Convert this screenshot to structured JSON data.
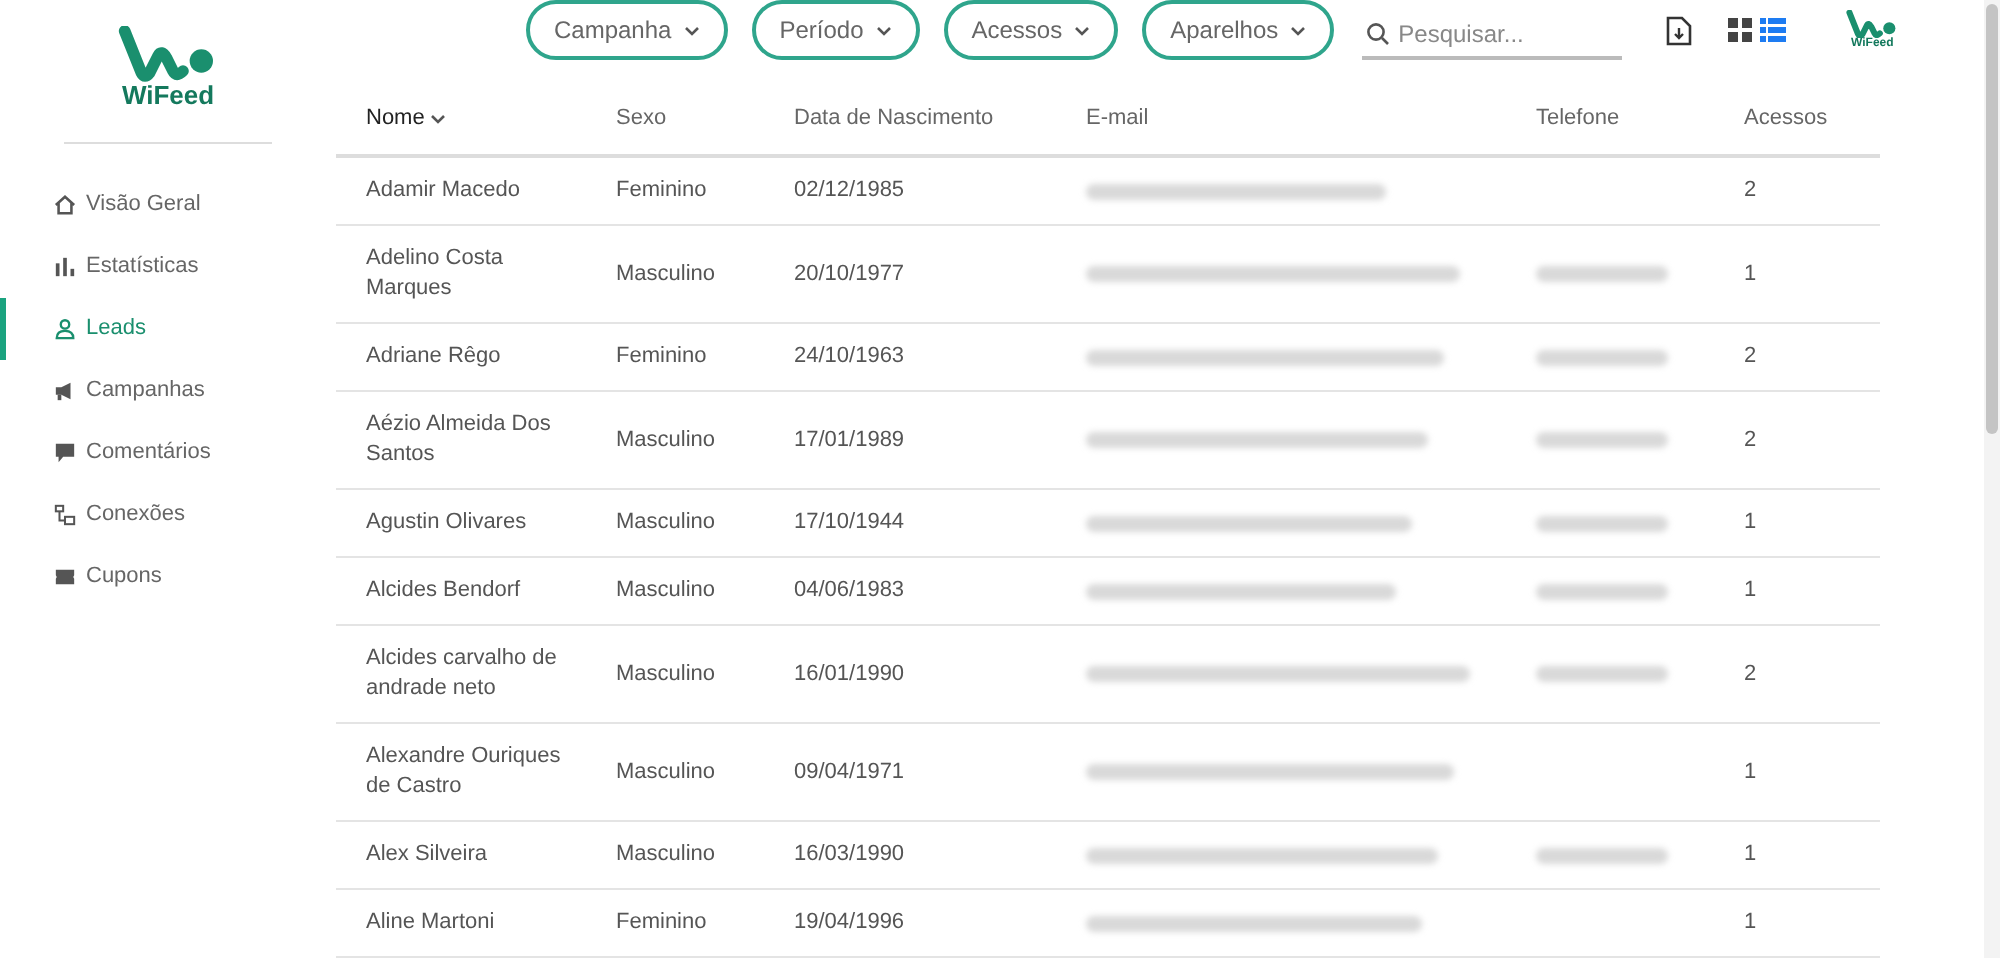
{
  "logo": {
    "text": "WiFeed"
  },
  "filters": [
    {
      "label": "Campanha"
    },
    {
      "label": "Período"
    },
    {
      "label": "Acessos"
    },
    {
      "label": "Aparelhos"
    }
  ],
  "search": {
    "placeholder": "Pesquisar..."
  },
  "view_toggle": [
    {
      "kind": "grid",
      "selected": false
    },
    {
      "kind": "list",
      "selected": true
    }
  ],
  "small_logo": {
    "text": "WiFeed"
  },
  "sidebar": {
    "items": [
      {
        "label": "Visão Geral",
        "selected": false
      },
      {
        "label": "Estatísticas",
        "selected": false
      },
      {
        "label": "Leads",
        "selected": true
      },
      {
        "label": "Campanhas",
        "selected": false
      },
      {
        "label": "Comentários",
        "selected": false
      },
      {
        "label": "Conexões",
        "selected": false
      },
      {
        "label": "Cupons",
        "selected": false
      }
    ]
  },
  "table": {
    "columns": [
      {
        "label": "Nome",
        "sorted": true
      },
      {
        "label": "Sexo",
        "sorted": false
      },
      {
        "label": "Data de Nascimento",
        "sorted": false
      },
      {
        "label": "E-mail",
        "sorted": false
      },
      {
        "label": "Telefone",
        "sorted": false
      },
      {
        "label": "Acessos",
        "sorted": false
      }
    ],
    "rows": [
      {
        "name": "Adamir Macedo",
        "sex": "Feminino",
        "birth": "02/12/1985",
        "email_redacted": true,
        "phone_redacted": false,
        "accesses": "2"
      },
      {
        "name": "Adelino Costa Marques",
        "sex": "Masculino",
        "birth": "20/10/1977",
        "email_redacted": true,
        "phone_redacted": true,
        "accesses": "1"
      },
      {
        "name": "Adriane Rêgo",
        "sex": "Feminino",
        "birth": "24/10/1963",
        "email_redacted": true,
        "phone_redacted": true,
        "accesses": "2"
      },
      {
        "name": "Aézio Almeida Dos Santos",
        "sex": "Masculino",
        "birth": "17/01/1989",
        "email_redacted": true,
        "phone_redacted": true,
        "accesses": "2"
      },
      {
        "name": "Agustin Olivares",
        "sex": "Masculino",
        "birth": "17/10/1944",
        "email_redacted": true,
        "phone_redacted": true,
        "accesses": "1"
      },
      {
        "name": "Alcides Bendorf",
        "sex": "Masculino",
        "birth": "04/06/1983",
        "email_redacted": true,
        "phone_redacted": true,
        "accesses": "1"
      },
      {
        "name": "Alcides carvalho de andrade neto",
        "sex": "Masculino",
        "birth": "16/01/1990",
        "email_redacted": true,
        "phone_redacted": true,
        "accesses": "2"
      },
      {
        "name": "Alexandre Ouriques de Castro",
        "sex": "Masculino",
        "birth": "09/04/1971",
        "email_redacted": true,
        "phone_redacted": false,
        "accesses": "1"
      },
      {
        "name": "Alex Silveira",
        "sex": "Masculino",
        "birth": "16/03/1990",
        "email_redacted": true,
        "phone_redacted": true,
        "accesses": "1"
      },
      {
        "name": "Aline Martoni",
        "sex": "Feminino",
        "birth": "19/04/1996",
        "email_redacted": true,
        "phone_redacted": false,
        "accesses": "1"
      }
    ]
  }
}
